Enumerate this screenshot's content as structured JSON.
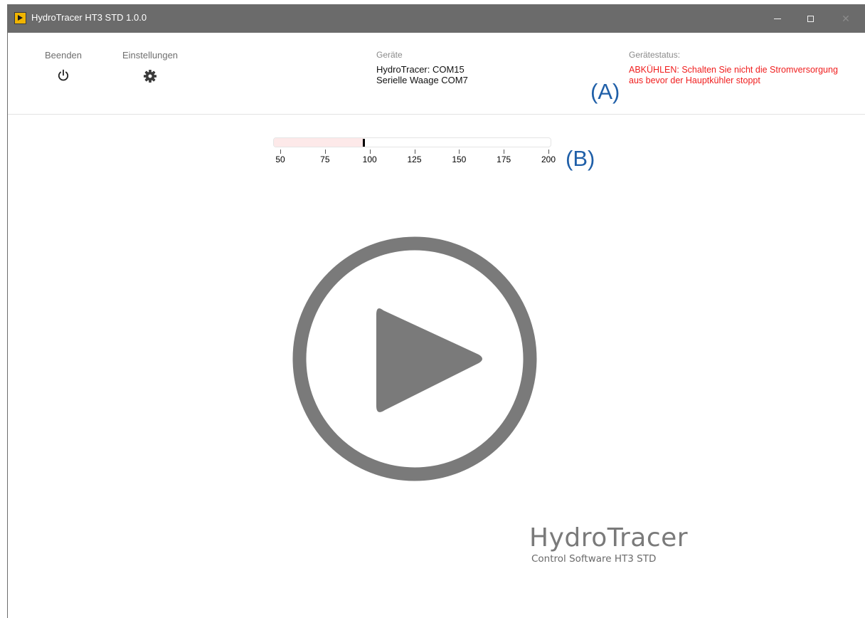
{
  "window": {
    "title": "HydroTracer HT3 STD 1.0.0",
    "minimize_glyph": "—",
    "close_glyph": "✕"
  },
  "toolbar": {
    "exit_label": "Beenden",
    "exit_icon": "power-icon",
    "settings_label": "Einstellungen",
    "settings_icon": "gear-icon"
  },
  "devices": {
    "header": "Geräte",
    "items": [
      "HydroTracer: COM15",
      "Serielle Waage COM7"
    ]
  },
  "device_status": {
    "header": "Gerätestatus:",
    "message": "ABKÜHLEN: Schalten Sie nicht die Stromversorgung aus bevor der Hauptkühler stoppt",
    "color": "#f01e1e"
  },
  "annotations": {
    "a": "(A)",
    "b": "(B)",
    "color": "#1f5fa8"
  },
  "gauge": {
    "min": 50,
    "max": 200,
    "value": 96,
    "ticks": [
      "50",
      "75",
      "100",
      "125",
      "150",
      "175",
      "200"
    ],
    "fill_color": "#fde9e9"
  },
  "play": {
    "icon": "play-icon",
    "color": "#7a7a7a"
  },
  "brand": {
    "name": "HydroTracer",
    "subtitle": "Control Software HT3 STD"
  }
}
